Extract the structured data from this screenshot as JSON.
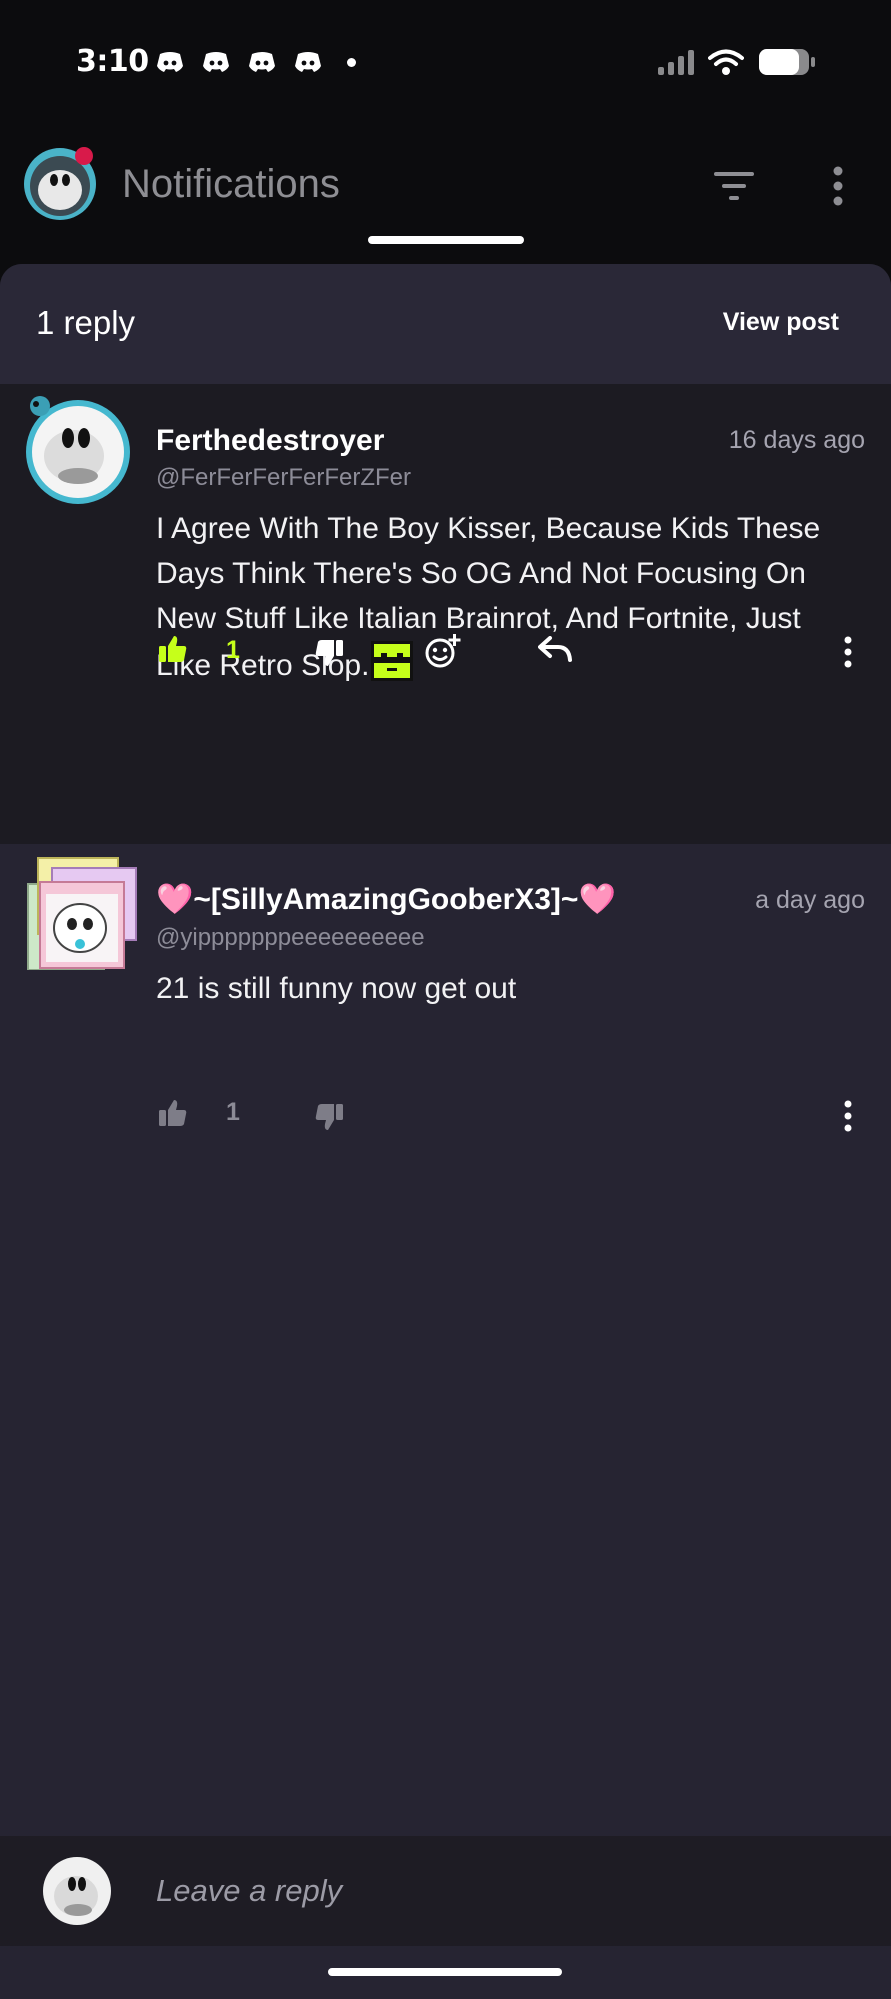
{
  "status_bar": {
    "time": "3:10"
  },
  "header": {
    "title": "Notifications"
  },
  "sheet": {
    "title": "1 reply",
    "view_post_label": "View post"
  },
  "comments": [
    {
      "author": "Ferthedestroyer",
      "handle": "@FerFerFerFerFerZFer",
      "time": "16 days ago",
      "body": "I Agree With The Boy Kisser, Because Kids These Days Think There's So OG And Not Focusing On New Stuff Like Italian Brainrot, And Fortnite, Just Like Retro Slop.",
      "likes": "1",
      "liked": true
    },
    {
      "author": "🩷~[SillyAmazingGooberX3]~🩷",
      "handle": "@yipppppppeeeeeeeeee",
      "time": "a day ago",
      "body": "21 is still funny now get out",
      "likes": "1",
      "liked": false
    }
  ],
  "reply_bar": {
    "placeholder": "Leave a reply"
  },
  "colors": {
    "accent_like": "#c6ff1a",
    "sheet_bg": "#262432",
    "highlight_bg": "#1c1b22"
  }
}
